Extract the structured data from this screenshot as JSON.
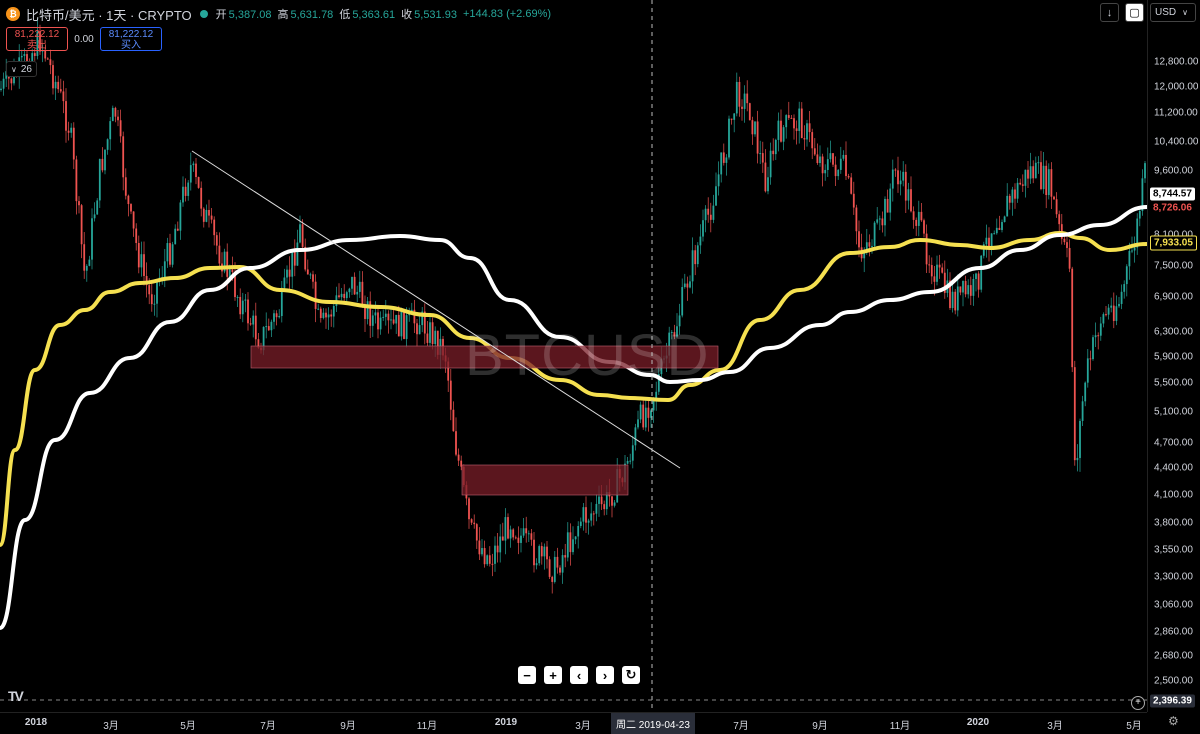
{
  "header": {
    "symbol_title": "比特币/美元 · 1天 · CRYPTO",
    "open_label": "开",
    "open": "5,387.08",
    "high_label": "高",
    "high": "5,631.78",
    "low_label": "低",
    "low": "5,363.61",
    "close_label": "收",
    "close": "5,531.93",
    "change": "+144.83 (+2.69%)"
  },
  "trade": {
    "sell_price": "81,222.12",
    "sell_label": "卖出",
    "spread": "0.00",
    "buy_price": "81,222.12",
    "buy_label": "买入"
  },
  "indicators_count": "26",
  "currency": "USD",
  "watermark": "BTCUSD",
  "price_axis": {
    "ticks": [
      "12,800.00",
      "12,000.00",
      "11,200.00",
      "10,400.00",
      "9,600.00",
      "8,100.00",
      "7,500.00",
      "6,900.00",
      "6,300.00",
      "5,900.00",
      "5,500.00",
      "5,100.00",
      "4,700.00",
      "4,400.00",
      "4,100.00",
      "3,800.00",
      "3,550.00",
      "3,300.00",
      "3,060.00",
      "2,860.00",
      "2,680.00",
      "2,500.00"
    ],
    "tags": [
      {
        "value": "8,744.57",
        "color": "#ffffff",
        "text": "#000000"
      },
      {
        "value": "8,726.06",
        "color": "#000000",
        "text": "#ef5350"
      },
      {
        "value": "7,933.05",
        "color": "#000000",
        "text": "#f5e050"
      }
    ],
    "crosshair_price": "2,396.39"
  },
  "time_axis": {
    "labels": [
      "2018",
      "3月",
      "5月",
      "7月",
      "9月",
      "11月",
      "2019",
      "3月",
      "7月",
      "9月",
      "11月",
      "2020",
      "3月",
      "5月"
    ],
    "crosshair_date": "周二 2019-04-23"
  },
  "colors": {
    "up": "#26a69a",
    "down": "#ef5350",
    "ma_fast": "#f5e050",
    "ma_slow": "#ffffff",
    "zone": "#7a1d28"
  },
  "icons": [
    "bitcoin-icon",
    "down-arrow-icon",
    "fullscreen-icon",
    "zoom-out-icon",
    "zoom-in-icon",
    "scroll-left-icon",
    "scroll-right-icon",
    "reset-icon",
    "settings-icon",
    "tradingview-logo-icon"
  ]
}
